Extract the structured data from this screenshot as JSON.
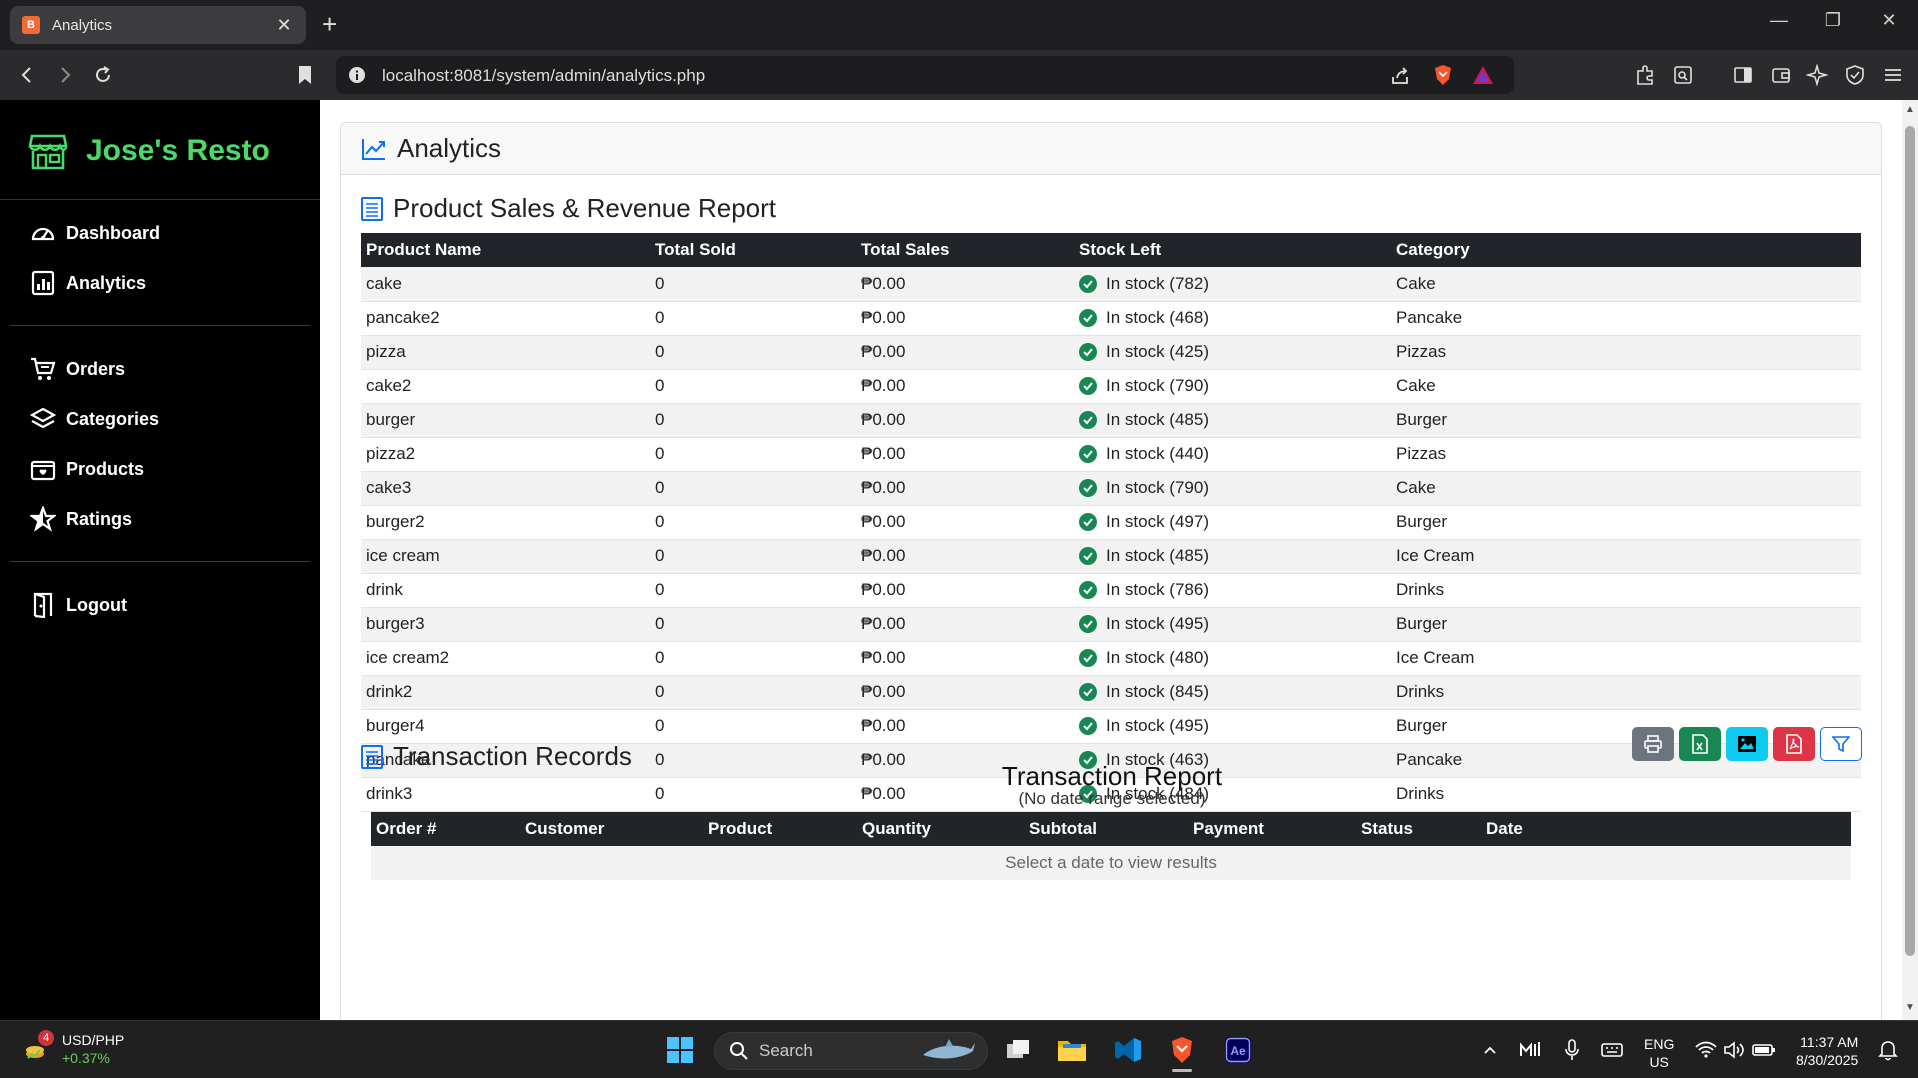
{
  "browser": {
    "tab_title": "Analytics",
    "url": "localhost:8081/system/admin/analytics.php",
    "favicon_letter": "B"
  },
  "sidebar": {
    "brand": "Jose's Resto",
    "items": [
      {
        "label": "Dashboard",
        "icon": "gauge-icon"
      },
      {
        "label": "Analytics",
        "icon": "bar-chart-icon"
      },
      {
        "label": "Orders",
        "icon": "cart-icon"
      },
      {
        "label": "Categories",
        "icon": "layers-icon"
      },
      {
        "label": "Products",
        "icon": "box-icon"
      },
      {
        "label": "Ratings",
        "icon": "star-icon"
      },
      {
        "label": "Logout",
        "icon": "door-icon"
      }
    ]
  },
  "page": {
    "title": "Analytics",
    "sales_section": "Product Sales & Revenue Report",
    "tx_section": "Transaction Records",
    "report_title": "Transaction Report",
    "report_subtitle": "(No date range selected)",
    "empty_message": "Select a date to view results"
  },
  "sales_table": {
    "headers": [
      "Product Name",
      "Total Sold",
      "Total Sales",
      "Stock Left",
      "Category"
    ],
    "rows": [
      [
        "cake",
        "0",
        "₱0.00",
        "In stock (782)",
        "Cake"
      ],
      [
        "pancake2",
        "0",
        "₱0.00",
        "In stock (468)",
        "Pancake"
      ],
      [
        "pizza",
        "0",
        "₱0.00",
        "In stock (425)",
        "Pizzas"
      ],
      [
        "cake2",
        "0",
        "₱0.00",
        "In stock (790)",
        "Cake"
      ],
      [
        "burger",
        "0",
        "₱0.00",
        "In stock (485)",
        "Burger"
      ],
      [
        "pizza2",
        "0",
        "₱0.00",
        "In stock (440)",
        "Pizzas"
      ],
      [
        "cake3",
        "0",
        "₱0.00",
        "In stock (790)",
        "Cake"
      ],
      [
        "burger2",
        "0",
        "₱0.00",
        "In stock (497)",
        "Burger"
      ],
      [
        "ice cream",
        "0",
        "₱0.00",
        "In stock (485)",
        "Ice Cream"
      ],
      [
        "drink",
        "0",
        "₱0.00",
        "In stock (786)",
        "Drinks"
      ],
      [
        "burger3",
        "0",
        "₱0.00",
        "In stock (495)",
        "Burger"
      ],
      [
        "ice cream2",
        "0",
        "₱0.00",
        "In stock (480)",
        "Ice Cream"
      ],
      [
        "drink2",
        "0",
        "₱0.00",
        "In stock (845)",
        "Drinks"
      ],
      [
        "burger4",
        "0",
        "₱0.00",
        "In stock (495)",
        "Burger"
      ],
      [
        "pancake",
        "0",
        "₱0.00",
        "In stock (463)",
        "Pancake"
      ],
      [
        "drink3",
        "0",
        "₱0.00",
        "In stock (484)",
        "Drinks"
      ]
    ]
  },
  "tx_table": {
    "headers": [
      "Order #",
      "Customer",
      "Product",
      "Quantity",
      "Subtotal",
      "Payment",
      "Status",
      "Date"
    ]
  },
  "export_buttons": [
    {
      "name": "print-button",
      "icon": "printer-icon",
      "color": "#6c757d"
    },
    {
      "name": "excel-button",
      "icon": "excel-icon",
      "color": "#198754"
    },
    {
      "name": "image-button",
      "icon": "image-icon",
      "color": "#0dcaf0"
    },
    {
      "name": "pdf-button",
      "icon": "pdf-icon",
      "color": "#dc3545"
    },
    {
      "name": "filter-button",
      "icon": "filter-icon",
      "color": "#0d6efd"
    }
  ],
  "taskbar": {
    "ticker_symbol": "USD/PHP",
    "ticker_change": "+0.37%",
    "ticker_badge": "4",
    "search_label": "Search",
    "lang": "ENG",
    "region": "US",
    "time": "11:37 AM",
    "date": "8/30/2025"
  },
  "colors": {
    "brand_green": "#4cd96a",
    "table_header": "#212529",
    "stock_ok": "#198754"
  }
}
